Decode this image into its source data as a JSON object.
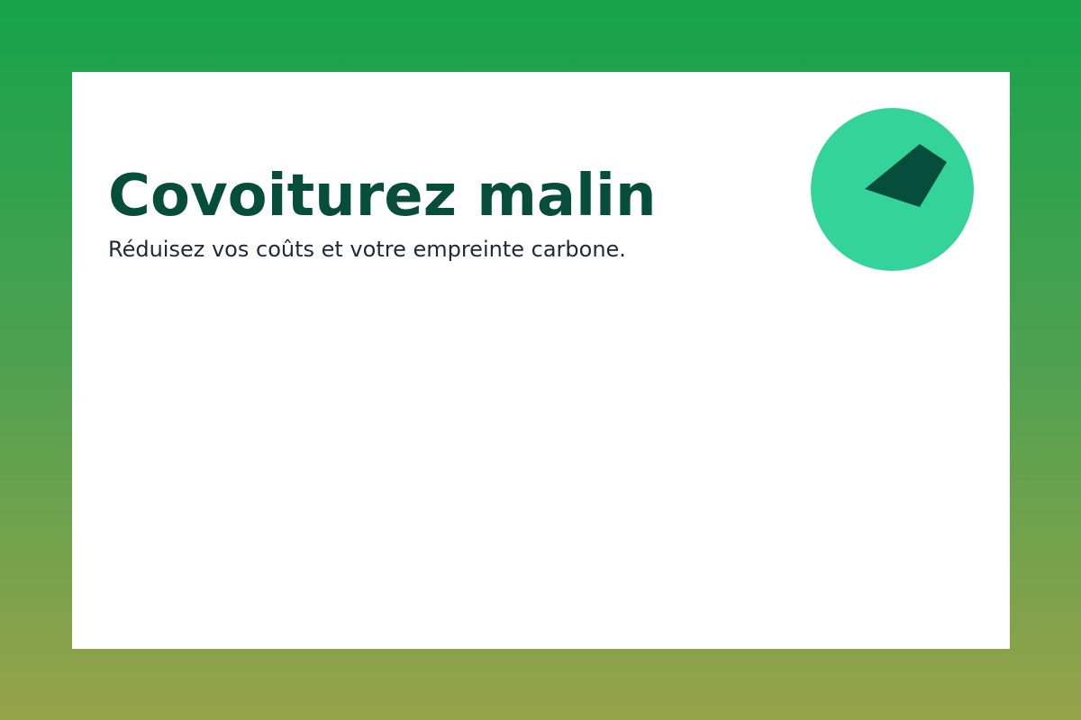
{
  "colors": {
    "gradient_top": "#16a34a",
    "gradient_bottom": "#97a349",
    "card": "#ffffff",
    "headline": "#064e3b",
    "subline": "#1f2937",
    "logo_circle": "#34d399",
    "logo_shape": "#064e3b"
  },
  "hero": {
    "title": "Covoiturez malin",
    "subtitle": "Réduisez vos coûts et votre empreinte carbone."
  },
  "logo": {
    "icon": "leaf-shard-icon"
  }
}
